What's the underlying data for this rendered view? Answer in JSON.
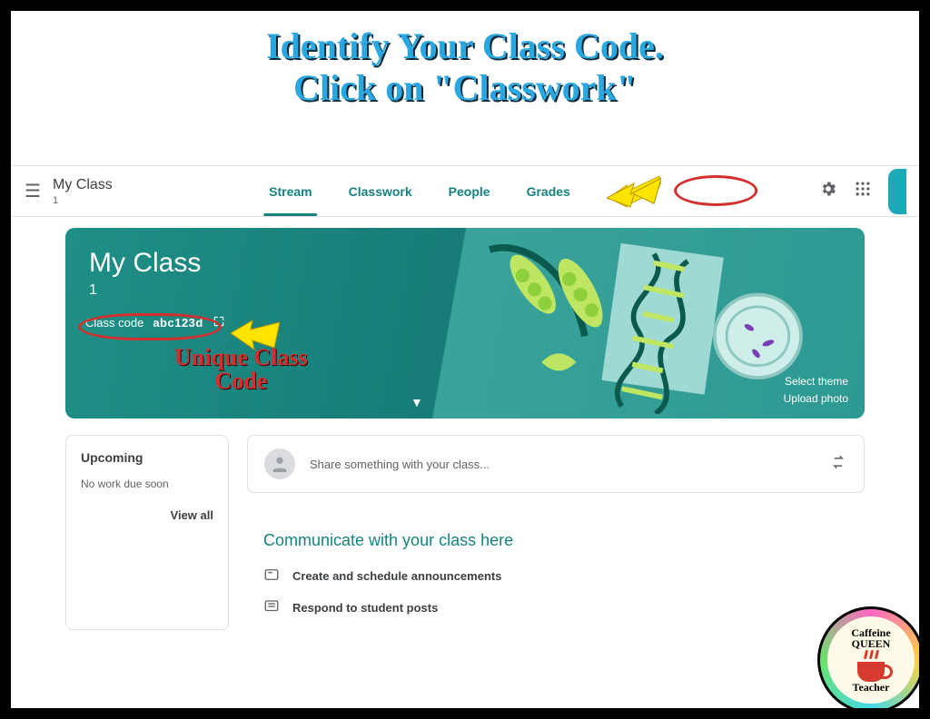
{
  "instructions": {
    "line1": "Identify Your Class Code.",
    "line2": "Click on \"Classwork\""
  },
  "topbar": {
    "class_name": "My Class",
    "class_section": "1",
    "tabs": {
      "stream": "Stream",
      "classwork": "Classwork",
      "people": "People",
      "grades": "Grades"
    }
  },
  "annotations": {
    "unique_code_label_l1": "Unique Class",
    "unique_code_label_l2": "Code"
  },
  "hero": {
    "title": "My Class",
    "subtitle": "1",
    "code_label": "Class code",
    "code_value": "abc123d",
    "select_theme": "Select theme",
    "upload_photo": "Upload photo"
  },
  "upcoming": {
    "heading": "Upcoming",
    "empty": "No work due soon",
    "view_all": "View all"
  },
  "stream": {
    "share_placeholder": "Share something with your class...",
    "communicate_heading": "Communicate with your class here",
    "row_announce": "Create and schedule announcements",
    "row_respond": "Respond to student posts"
  },
  "logo": {
    "l1": "Caffeine",
    "l2": "QUEEN",
    "l3": "Teacher"
  }
}
